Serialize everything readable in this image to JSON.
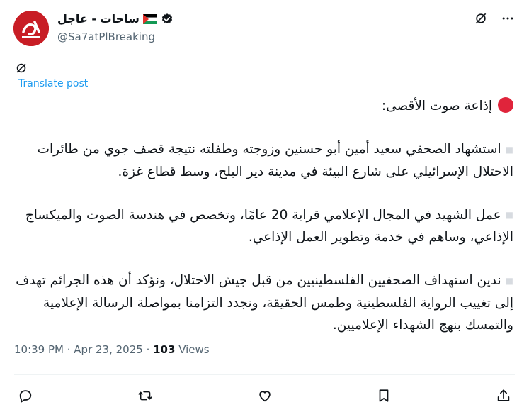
{
  "author": {
    "display_name": "ساحات - عاجل",
    "handle": "@Sa7atPlBreaking"
  },
  "icons": {
    "avatar": "avatar-logo",
    "flag": "palestine-flag-icon",
    "verified": "verified-badge-icon",
    "grok": "grok-icon",
    "more": "more-options-icon",
    "reply": "reply-icon",
    "repost": "repost-icon",
    "like": "like-icon",
    "bookmark": "bookmark-icon",
    "share": "share-icon"
  },
  "colors": {
    "link": "#1d9bf0",
    "avatar_bg": "#c81d25",
    "muted": "#536471",
    "red_dot": "#e0243b"
  },
  "translate_label": "Translate post",
  "tweet": {
    "heading": "إذاعة صوت الأقصى:",
    "paragraphs": [
      "استشهاد الصحفي سعيد أمين أبو حسنين وزوجته وطفلته نتيجة قصف جوي من طائرات الاحتلال الإسرائيلي على شارع البيئة في مدينة دير البلح، وسط قطاع غزة.",
      "عمل الشهيد في المجال الإعلامي قرابة 20 عامًا، وتخصص في هندسة الصوت والميكساج الإذاعي، وساهم في خدمة وتطوير العمل الإذاعي.",
      "ندين استهداف الصحفيين الفلسطينيين من قبل جيش الاحتلال، ونؤكد أن هذه الجرائم تهدف إلى تغييب الرواية الفلسطينية وطمس الحقيقة، ونجدد التزامنا بمواصلة الرسالة الإعلامية والتمسك بنهج الشهداء الإعلاميين."
    ]
  },
  "meta": {
    "time": "10:39 PM",
    "separator1": " · ",
    "date": "Apr 23, 2025",
    "separator2": " · ",
    "views_count": "103",
    "views_label": " Views"
  }
}
